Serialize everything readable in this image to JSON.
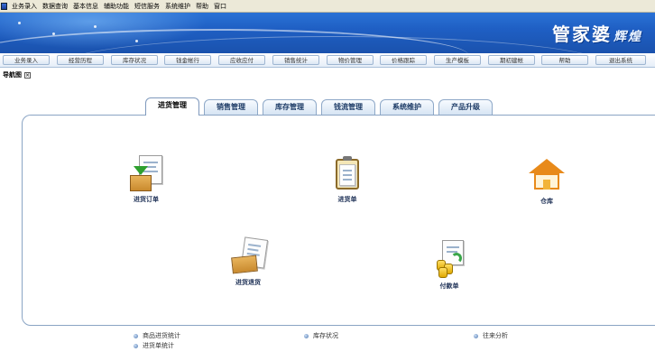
{
  "menubar": {
    "items": [
      "业务录入",
      "数据查询",
      "基本信息",
      "辅助功能",
      "短信服务",
      "系统维护",
      "帮助",
      "窗口"
    ]
  },
  "banner": {
    "brand": "管家婆",
    "brand_sub": "辉煌"
  },
  "toolbar": {
    "buttons": [
      "业务录入",
      "经营历程",
      "库存状况",
      "钱金帐行",
      "应收应付",
      "销售统计",
      "物价管理",
      "价格跟踪",
      "生产模板",
      "期初建帐",
      "帮助",
      "退出系统"
    ]
  },
  "nav": {
    "label": "导航图",
    "close_icon": "close-icon"
  },
  "tabs": [
    {
      "label": "进货管理",
      "active": true
    },
    {
      "label": "销售管理",
      "active": false
    },
    {
      "label": "库存管理",
      "active": false
    },
    {
      "label": "钱流管理",
      "active": false
    },
    {
      "label": "系统维护",
      "active": false
    },
    {
      "label": "产品升级",
      "active": false
    }
  ],
  "tiles": [
    {
      "label": "进货订单",
      "icon": "purchase-order-icon"
    },
    {
      "label": "进货单",
      "icon": "purchase-receipt-icon"
    },
    {
      "label": "仓库",
      "icon": "warehouse-icon"
    },
    {
      "label": "进货退货",
      "icon": "purchase-return-icon"
    },
    {
      "label": "付款单",
      "icon": "payment-voucher-icon"
    }
  ],
  "bottom_links": [
    {
      "label": "商品进货统计"
    },
    {
      "label": "进货单统计"
    },
    {
      "label": "库存状况"
    },
    {
      "label": "往来分析"
    }
  ],
  "colors": {
    "banner": "#1f5fc4",
    "tab_text": "#1d3b66",
    "panel_border": "#8aa4c4"
  }
}
